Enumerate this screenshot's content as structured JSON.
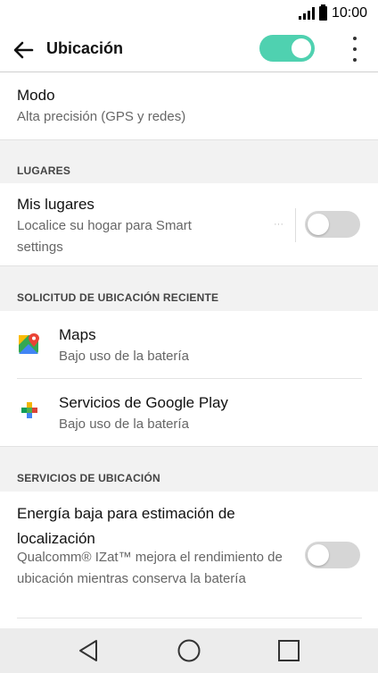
{
  "status_bar": {
    "time": "10:00"
  },
  "app_bar": {
    "title": "Ubicación",
    "location_enabled": true
  },
  "mode": {
    "title": "Modo",
    "value": "Alta precisión (GPS y redes)"
  },
  "places": {
    "header": "LUGARES",
    "title": "Mis lugares",
    "subtitle": "Localice su hogar para Smart settings",
    "enabled": false
  },
  "recent": {
    "header": "SOLICITUD DE UBICACIÓN RECIENTE",
    "apps": [
      {
        "name": "Maps",
        "usage": "Bajo uso de la batería",
        "icon": "google-maps-icon"
      },
      {
        "name": "Servicios de Google Play",
        "usage": "Bajo uso de la batería",
        "icon": "google-play-services-icon"
      }
    ]
  },
  "services": {
    "header": "SERVICIOS DE UBICACIÓN",
    "title": "Energía baja para estimación de localización",
    "subtitle": "Qualcomm® IZat™ mejora el rendimiento de ubicación mientras conserva la batería",
    "enabled": false
  },
  "colors": {
    "accent": "#4fd1b0",
    "toggle_off": "#d6d6d6",
    "header_bg": "#f2f2f2"
  }
}
